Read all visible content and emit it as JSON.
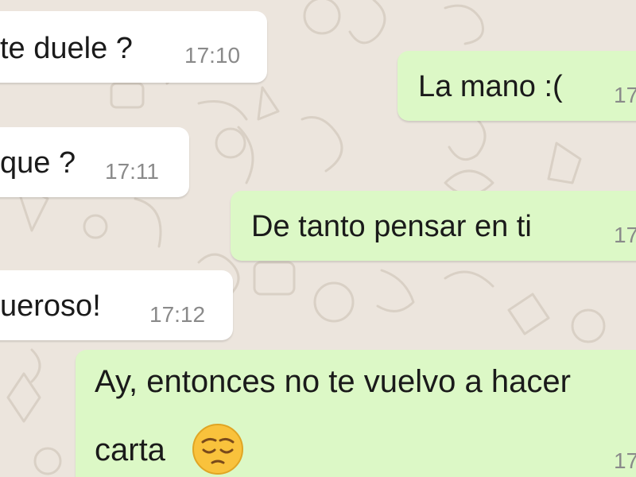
{
  "conversation": {
    "messages": [
      {
        "side": "incoming",
        "text": "te duele ?",
        "time": "17:10"
      },
      {
        "side": "outgoing",
        "text": "La mano :(",
        "time": "17"
      },
      {
        "side": "incoming",
        "text": "que ?",
        "time": "17:11"
      },
      {
        "side": "outgoing",
        "text": "De tanto pensar en ti",
        "time": "17"
      },
      {
        "side": "incoming",
        "text": "ueroso!",
        "time": "17:12"
      },
      {
        "side": "outgoing",
        "text_line1": "Ay, entonces no te vuelvo a hacer",
        "text_line2": "carta",
        "emoji": "pensive-face-icon",
        "time": "17"
      }
    ]
  },
  "colors": {
    "background": "#ECE5DD",
    "incoming_bubble": "#FFFFFF",
    "outgoing_bubble": "#DCF8C6",
    "timestamp": "#8A8A8A",
    "emoji_yellow": "#F9C23C"
  }
}
